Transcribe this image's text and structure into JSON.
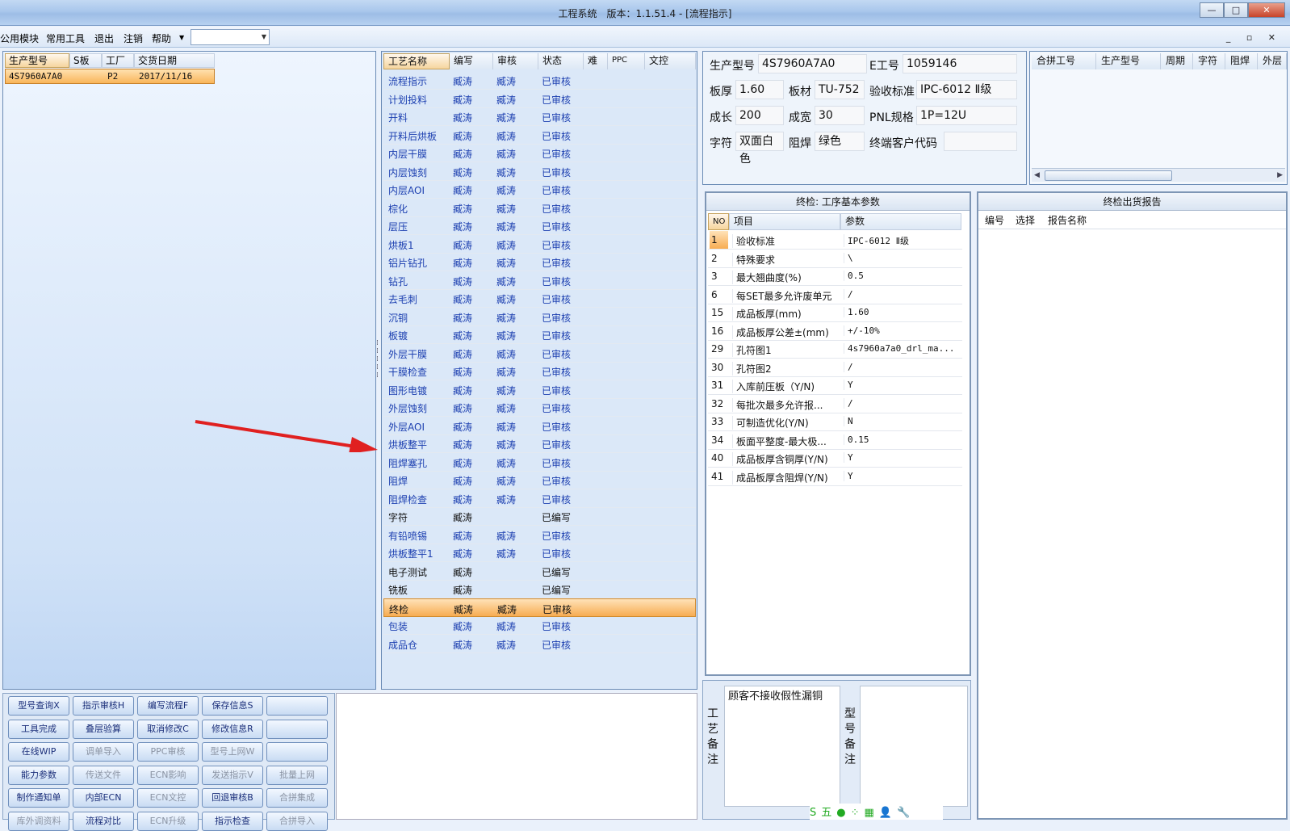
{
  "window": {
    "title": "工程系统　版本：1.1.51.4 - [流程指示]",
    "controls": [
      "—",
      "□",
      "✕"
    ]
  },
  "menu": {
    "items": [
      "公用模块",
      "常用工具",
      "退出",
      "注销",
      "帮助"
    ],
    "combo_value": "",
    "mdi_controls": "_ ▫ ✕"
  },
  "order_grid": {
    "headers": [
      "生产型号",
      "S板",
      "工厂",
      "交货日期"
    ],
    "rows": [
      [
        "4S7960A7A0",
        "",
        "P2",
        "2017/11/16"
      ]
    ]
  },
  "process_grid": {
    "headers": [
      "工艺名称",
      "编写",
      "审核",
      "状态",
      "难",
      "PPC",
      "文控"
    ],
    "rows": [
      [
        "流程指示",
        "臧涛",
        "臧涛",
        "已审核"
      ],
      [
        "计划投料",
        "臧涛",
        "臧涛",
        "已审核"
      ],
      [
        "开料",
        "臧涛",
        "臧涛",
        "已审核"
      ],
      [
        "开料后烘板",
        "臧涛",
        "臧涛",
        "已审核"
      ],
      [
        "内层干膜",
        "臧涛",
        "臧涛",
        "已审核"
      ],
      [
        "内层蚀刻",
        "臧涛",
        "臧涛",
        "已审核"
      ],
      [
        "内层AOI",
        "臧涛",
        "臧涛",
        "已审核"
      ],
      [
        "棕化",
        "臧涛",
        "臧涛",
        "已审核"
      ],
      [
        "层压",
        "臧涛",
        "臧涛",
        "已审核"
      ],
      [
        "烘板1",
        "臧涛",
        "臧涛",
        "已审核"
      ],
      [
        "铝片钻孔",
        "臧涛",
        "臧涛",
        "已审核"
      ],
      [
        "钻孔",
        "臧涛",
        "臧涛",
        "已审核"
      ],
      [
        "去毛刺",
        "臧涛",
        "臧涛",
        "已审核"
      ],
      [
        "沉铜",
        "臧涛",
        "臧涛",
        "已审核"
      ],
      [
        "板镀",
        "臧涛",
        "臧涛",
        "已审核"
      ],
      [
        "外层干膜",
        "臧涛",
        "臧涛",
        "已审核"
      ],
      [
        "干膜检查",
        "臧涛",
        "臧涛",
        "已审核"
      ],
      [
        "图形电镀",
        "臧涛",
        "臧涛",
        "已审核"
      ],
      [
        "外层蚀刻",
        "臧涛",
        "臧涛",
        "已审核"
      ],
      [
        "外层AOI",
        "臧涛",
        "臧涛",
        "已审核"
      ],
      [
        "烘板整平",
        "臧涛",
        "臧涛",
        "已审核"
      ],
      [
        "阻焊塞孔",
        "臧涛",
        "臧涛",
        "已审核"
      ],
      [
        "阻焊",
        "臧涛",
        "臧涛",
        "已审核"
      ],
      [
        "阻焊检查",
        "臧涛",
        "臧涛",
        "已审核"
      ],
      [
        "字符",
        "臧涛",
        "",
        "已编写"
      ],
      [
        "有铅喷锡",
        "臧涛",
        "臧涛",
        "已审核"
      ],
      [
        "烘板整平1",
        "臧涛",
        "臧涛",
        "已审核"
      ],
      [
        "电子测试",
        "臧涛",
        "",
        "已编写"
      ],
      [
        "铣板",
        "臧涛",
        "",
        "已编写"
      ],
      [
        "终检",
        "臧涛",
        "臧涛",
        "已审核"
      ],
      [
        "包装",
        "臧涛",
        "臧涛",
        "已审核"
      ],
      [
        "成品仓",
        "臧涛",
        "臧涛",
        "已审核"
      ]
    ],
    "selected_index": 29
  },
  "buttons": [
    [
      "型号查询X",
      "指示审核H",
      "编写流程F",
      "保存信息S",
      ""
    ],
    [
      "工具完成",
      "叠层验算",
      "取消修改C",
      "修改信息R",
      ""
    ],
    [
      "在线WIP",
      "调单导入",
      "PPC审核",
      "型号上网W",
      ""
    ],
    [
      "能力参数",
      "传送文件",
      "ECN影响",
      "发送指示V",
      "批量上网"
    ],
    [
      "制作通知单",
      "内部ECN",
      "ECN文控",
      "回退审核B",
      "合拼集成"
    ],
    [
      "库外调资料",
      "流程对比",
      "ECN升级",
      "指示检查",
      "合拼导入"
    ]
  ],
  "disabled_buttons": [
    "调单导入",
    "PPC审核",
    "型号上网W",
    "传送文件",
    "ECN影响",
    "发送指示V",
    "批量上网",
    "ECN文控",
    "合拼集成",
    "ECN升级",
    "合拼导入",
    "库外调资料"
  ],
  "info": {
    "model_label": "生产型号",
    "model": "4S7960A7A0",
    "e_label": "E工号",
    "e_no": "1059146",
    "thick_label": "板厚",
    "thick": "1.60",
    "material_label": "板材",
    "material": "TU-752",
    "std_label": "验收标准",
    "std": "IPC-6012 Ⅱ级",
    "len_label": "成长",
    "len": "200",
    "wid_label": "成宽",
    "wid": "30",
    "pnl_label": "PNL规格",
    "pnl": "1P=12U",
    "char_label": "字符",
    "char": "双面白色",
    "mask_label": "阻焊",
    "mask": "绿色",
    "cust_label": "终端客户代码",
    "cust": ""
  },
  "merge_grid": {
    "headers": [
      "合拼工号",
      "生产型号",
      "周期",
      "字符",
      "阻焊",
      "外层"
    ]
  },
  "params": {
    "caption": "终检: 工序基本参数",
    "headers": [
      "NO",
      "项目",
      "参数"
    ],
    "rows": [
      [
        "1",
        "验收标准",
        "IPC-6012 Ⅱ级"
      ],
      [
        "2",
        "特殊要求",
        "\\"
      ],
      [
        "3",
        "最大翘曲度(%)",
        "0.5"
      ],
      [
        "6",
        "每SET最多允许废单元",
        "/"
      ],
      [
        "15",
        "成品板厚(mm)",
        "1.60"
      ],
      [
        "16",
        "成品板厚公差±(mm)",
        "+/-10%"
      ],
      [
        "29",
        "孔符图1",
        "4s7960a7a0_drl_ma..."
      ],
      [
        "30",
        "孔符图2",
        "/"
      ],
      [
        "31",
        "入库前压板（Y/N)",
        "Y"
      ],
      [
        "32",
        "每批次最多允许报...",
        "/"
      ],
      [
        "33",
        "可制造优化(Y/N)",
        "N"
      ],
      [
        "34",
        "板面平整度-最大极...",
        "0.15"
      ],
      [
        "40",
        "成品板厚含铜厚(Y/N)",
        "Y"
      ],
      [
        "41",
        "成品板厚含阻焊(Y/N)",
        "Y"
      ]
    ]
  },
  "report": {
    "caption": "终检出货报告",
    "headers": [
      "编号",
      "选择",
      "报告名称"
    ]
  },
  "remarks": {
    "process_label": "工艺备注",
    "process_text": "顾客不接收假性漏铜",
    "model_label": "型号备注",
    "model_text": ""
  },
  "tray": {
    "items": [
      "S",
      "五",
      "●",
      "⁘",
      "▦",
      "👤",
      "🔧"
    ]
  },
  "colors": {
    "selection": "#f9b55a",
    "text_blue": "#1c3fb0",
    "arrow": "#e02020"
  }
}
